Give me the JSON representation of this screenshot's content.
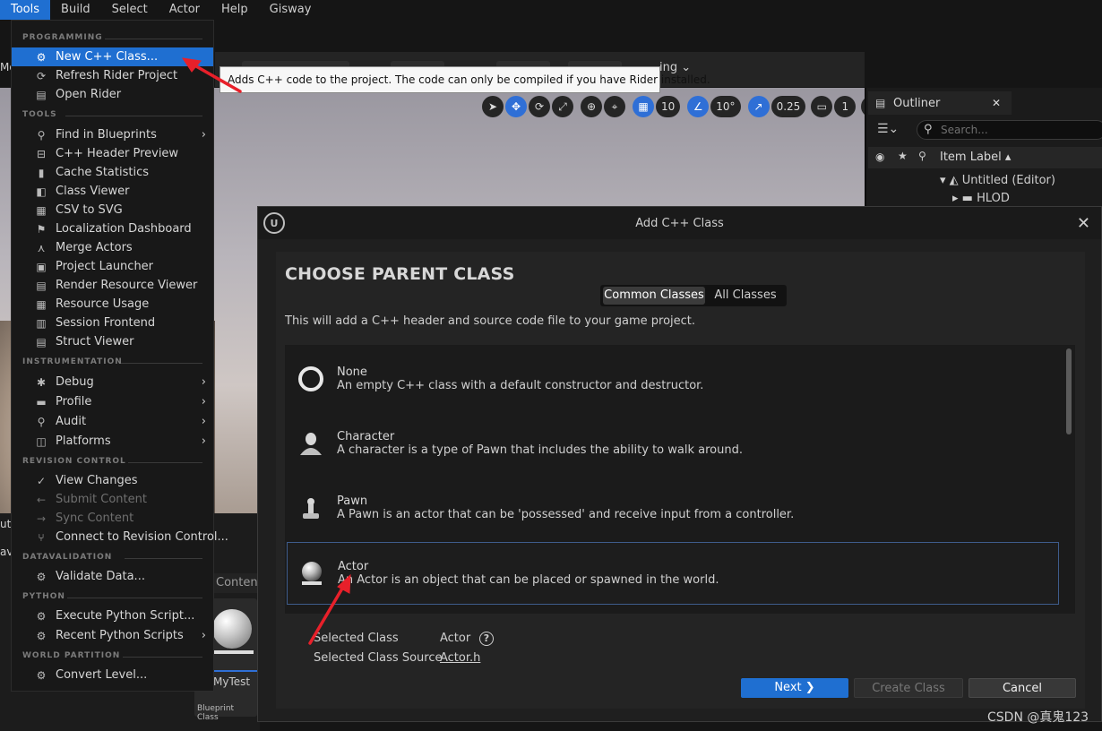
{
  "menubar": [
    "Tools",
    "Build",
    "Select",
    "Actor",
    "Help",
    "Gisway"
  ],
  "toolbar": {
    "partial_text": "ing"
  },
  "viewport": {
    "grid_value": "10",
    "angle_value": "10°",
    "scale_value": "0.25",
    "camera_value": "1"
  },
  "left_edge": {
    "top": "Mo",
    "a": "ut",
    "b": "av"
  },
  "content_tab": "Content",
  "asset": {
    "name": "MyTest",
    "type": "Blueprint Class"
  },
  "outliner": {
    "title": "Outliner",
    "search_placeholder": "Search...",
    "column": "Item Label",
    "rows": [
      "Untitled (Editor)",
      "HLOD"
    ]
  },
  "tools_menu": {
    "sections": {
      "programming": "PROGRAMMING",
      "tools": "TOOLS",
      "instrumentation": "INSTRUMENTATION",
      "revision": "REVISION CONTROL",
      "datavalidation": "DATAVALIDATION",
      "python": "PYTHON",
      "world_partition": "WORLD PARTITION"
    },
    "programming": [
      "New C++ Class...",
      "Refresh Rider Project",
      "Open Rider"
    ],
    "tools": [
      "Find in Blueprints",
      "C++ Header Preview",
      "Cache Statistics",
      "Class Viewer",
      "CSV to SVG",
      "Localization Dashboard",
      "Merge Actors",
      "Project Launcher",
      "Render Resource Viewer",
      "Resource Usage",
      "Session Frontend",
      "Struct Viewer"
    ],
    "instrumentation": [
      "Debug",
      "Profile",
      "Audit",
      "Platforms"
    ],
    "revision": [
      "View Changes",
      "Submit Content",
      "Sync Content",
      "Connect to Revision Control..."
    ],
    "datavalidation": [
      "Validate Data..."
    ],
    "python": [
      "Execute Python Script...",
      "Recent Python Scripts"
    ],
    "world_partition": [
      "Convert Level..."
    ]
  },
  "tooltip": "Adds C++ code to the project. The code can only be compiled if you have Rider installed.",
  "dialog": {
    "title": "Add C++ Class",
    "heading": "CHOOSE PARENT CLASS",
    "tabs": [
      "Common Classes",
      "All Classes"
    ],
    "subtitle": "This will add a C++ header and source code file to your game project.",
    "classes": [
      {
        "name": "None",
        "desc": "An empty C++ class with a default constructor and destructor."
      },
      {
        "name": "Character",
        "desc": "A character is a type of Pawn that includes the ability to walk around."
      },
      {
        "name": "Pawn",
        "desc": "A Pawn is an actor that can be 'possessed' and receive input from a controller."
      },
      {
        "name": "Actor",
        "desc": "An Actor is an object that can be placed or spawned in the world."
      }
    ],
    "selected_class_label": "Selected Class",
    "selected_class_value": "Actor",
    "selected_source_label": "Selected Class Source",
    "selected_source_value": "Actor.h",
    "buttons": {
      "next": "Next",
      "create": "Create Class",
      "cancel": "Cancel"
    }
  },
  "watermark": "CSDN @真鬼123",
  "colors": {
    "accent": "#1f6fd1",
    "annotation": "#e8202a"
  }
}
